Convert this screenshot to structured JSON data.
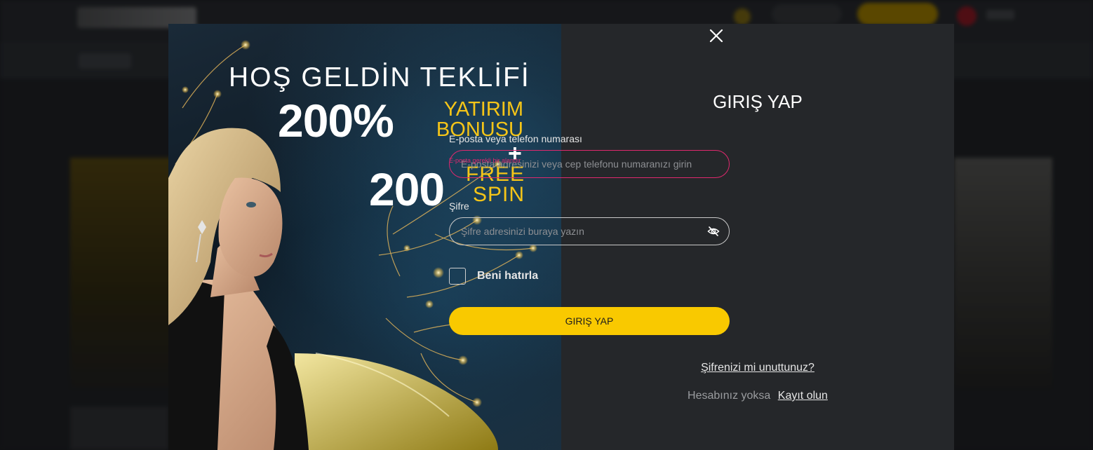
{
  "promo": {
    "headline": "HOŞ GELDİN  TEKLİFİ",
    "percent": "200%",
    "bonus_line1": "YATIRIM",
    "bonus_line2": "BONUSU",
    "plus": "+",
    "spins": "200",
    "free_line1": "FREE",
    "free_line2": "SPIN"
  },
  "login": {
    "title": "GIRIŞ YAP",
    "email_label": "E-posta veya telefon numarası",
    "email_placeholder": "E-posta adresinizi veya cep telefonu numaranızı girin",
    "email_error": "E-posta gerekli bir alandır",
    "password_label": "Şifre",
    "password_placeholder": "Şifre adresinizi buraya yazın",
    "remember_label": "Beni hatırla",
    "remember_checked": false,
    "submit_label": "GIRIŞ YAP",
    "forgot_label": "Şifrenizi mi unuttunuz?",
    "no_account_text": "Hesabınız yoksa",
    "register_label": "Kayıt olun"
  },
  "colors": {
    "accent": "#f9c900",
    "error": "#e0286e",
    "panel": "#25272a"
  },
  "icons": {
    "close": "close-icon",
    "password_toggle": "eye-slash-icon"
  }
}
